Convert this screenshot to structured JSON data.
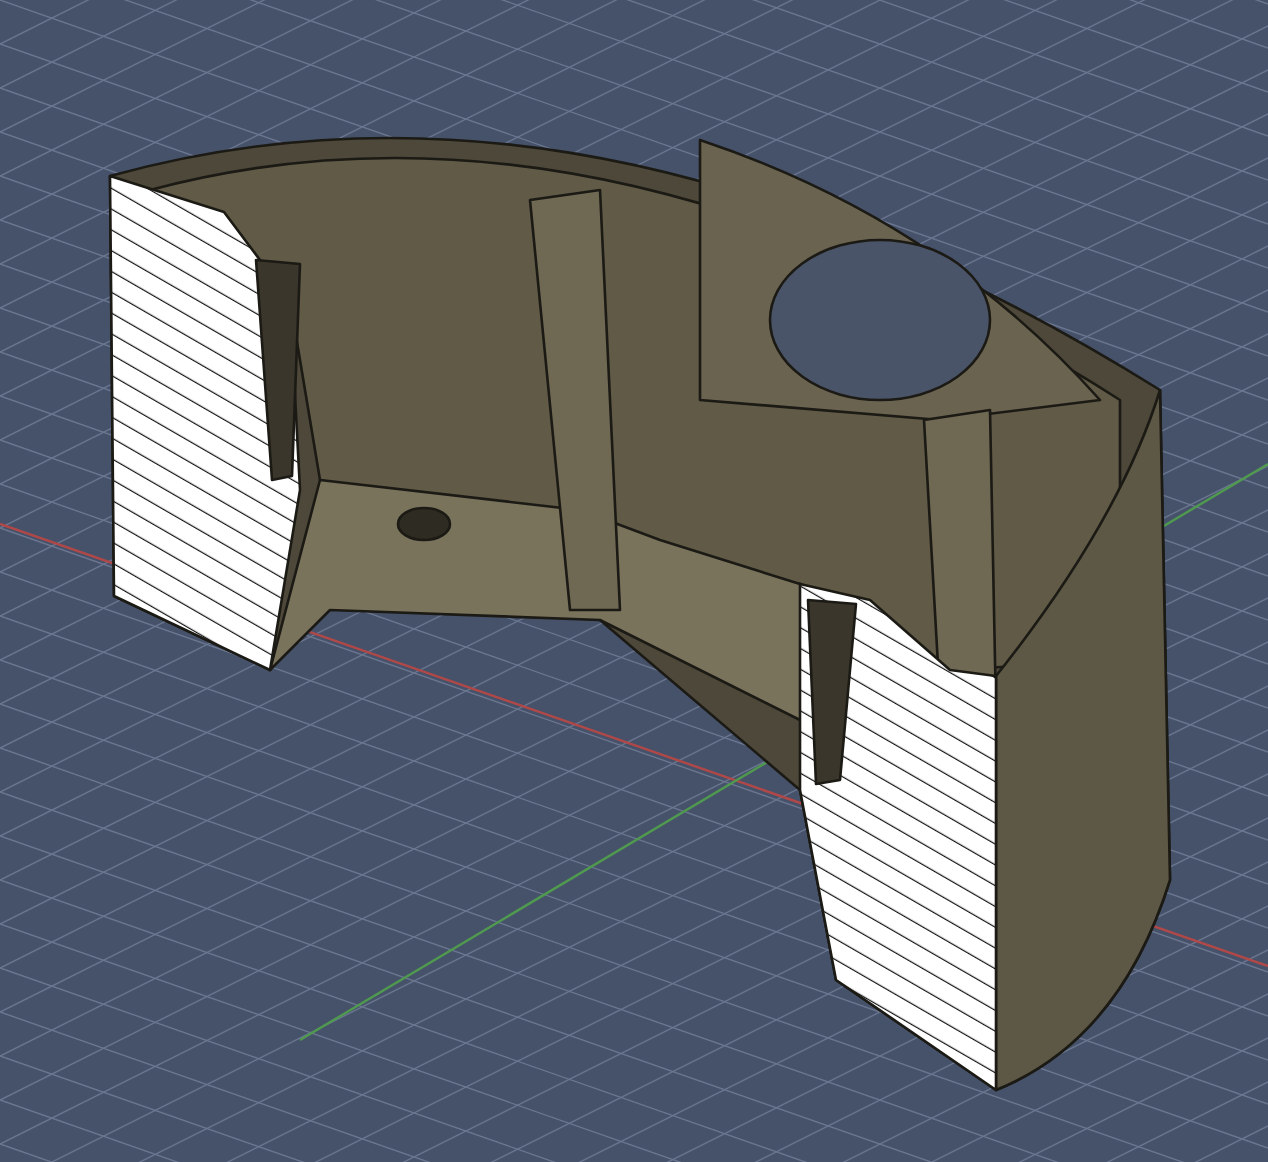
{
  "viewport": {
    "grid_visible": true,
    "axes_visible": true,
    "section_view": true
  }
}
